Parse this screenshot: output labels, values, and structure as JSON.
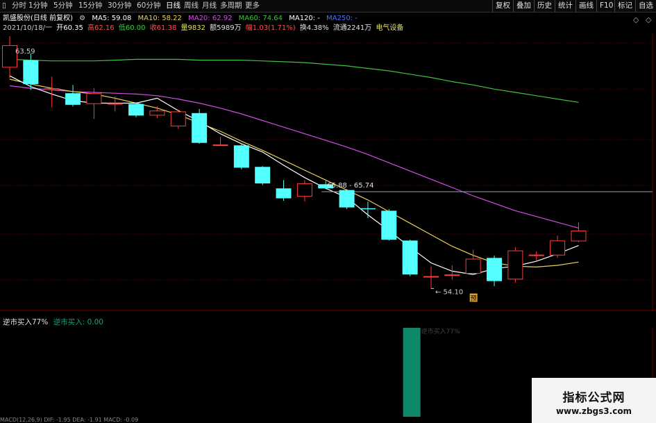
{
  "toolbar": {
    "periods": [
      "分时",
      "1分钟",
      "5分钟",
      "15分钟",
      "30分钟",
      "60分钟",
      "日线",
      "周线",
      "月线",
      "多周期",
      "更多"
    ],
    "active_period": "日线",
    "right_buttons": [
      "复权",
      "叠加",
      "历史",
      "统计",
      "画线",
      "F10",
      "标记",
      "自选"
    ]
  },
  "header": {
    "stock_name": "凯盛股份(日线 前复权)",
    "ma5_label": "MA5: 59.08",
    "ma10_label": "MA10: 58.22",
    "ma20_label": "MA20: 62.92",
    "ma60_label": "MA60: 74.64",
    "ma120_label": "MA120: -",
    "ma250_label": "MA250: -",
    "date": "2021/10/18/一",
    "open": "开60.35",
    "high": "高62.16",
    "low": "低60.00",
    "close": "收61.38",
    "volume": "量9832",
    "amount": "额5989万",
    "change": "幅1.03(1.71%)",
    "turnover": "换4.38%",
    "float_cap": "流通2241万",
    "sector": "电气设备"
  },
  "chart_labels": {
    "high_label": "63.59",
    "low_label": "54.10",
    "range_label": "65.88 - 65.74",
    "signal_badge": "预",
    "bar_annotation": "逆市买入77%"
  },
  "indicator": {
    "name": "逆市买入77%",
    "value_label": "逆市买入: 0.00",
    "bottom_text": "MACD(12,26,9) DIF: -1.95 DEA: -1.91 MACD: -0.09"
  },
  "watermark": {
    "title": "指标公式网",
    "url": "www.zbgs3.com"
  },
  "colors": {
    "up": "#ff3c3c",
    "down": "#54ffff",
    "ma5": "#ffffff",
    "ma10": "#e8d05a",
    "ma20": "#d050e0",
    "ma60": "#40c040",
    "grid": "#6b0000",
    "signal_bar": "#0e8a6a"
  },
  "chart_data": {
    "type": "candlestick",
    "price_range": [
      52.5,
      76.8
    ],
    "candles": [
      {
        "o": 73.6,
        "c": 76.3,
        "h": 77.4,
        "l": 72.3
      },
      {
        "o": 74.5,
        "c": 71.6,
        "h": 75.3,
        "l": 70.9
      },
      {
        "o": 70.9,
        "c": 71.1,
        "h": 72.5,
        "l": 68.8
      },
      {
        "o": 70.5,
        "c": 69.1,
        "h": 71.5,
        "l": 68.9
      },
      {
        "o": 69.2,
        "c": 70.5,
        "h": 71.1,
        "l": 67.4
      },
      {
        "o": 69.2,
        "c": 69.3,
        "h": 70.1,
        "l": 68.3
      },
      {
        "o": 69.2,
        "c": 67.8,
        "h": 69.4,
        "l": 67.6
      },
      {
        "o": 67.8,
        "c": 68.4,
        "h": 68.9,
        "l": 67.5
      },
      {
        "o": 66.5,
        "c": 68.3,
        "h": 68.5,
        "l": 66.2
      },
      {
        "o": 68.1,
        "c": 64.5,
        "h": 68.6,
        "l": 64.4
      },
      {
        "o": 64.3,
        "c": 64.3,
        "h": 65.2,
        "l": 64.2
      },
      {
        "o": 64.2,
        "c": 61.5,
        "h": 64.4,
        "l": 61.3
      },
      {
        "o": 61.6,
        "c": 59.6,
        "h": 61.7,
        "l": 59.4
      },
      {
        "o": 59.0,
        "c": 57.8,
        "h": 60.0,
        "l": 57.5
      },
      {
        "o": 58.0,
        "c": 59.6,
        "h": 60.0,
        "l": 57.4
      },
      {
        "o": 59.5,
        "c": 59.0,
        "h": 59.9,
        "l": 58.9
      },
      {
        "o": 58.8,
        "c": 56.7,
        "h": 58.9,
        "l": 56.5
      },
      {
        "o": 56.6,
        "c": 56.5,
        "h": 57.4,
        "l": 55.4
      },
      {
        "o": 56.3,
        "c": 52.8,
        "h": 56.5,
        "l": 52.7
      },
      {
        "o": 52.7,
        "c": 48.6,
        "h": 52.8,
        "l": 48.4
      },
      {
        "o": 48.4,
        "c": 48.4,
        "h": 49.6,
        "l": 46.9
      },
      {
        "o": 48.5,
        "c": 48.6,
        "h": 49.7,
        "l": 48.0
      },
      {
        "o": 48.7,
        "c": 50.5,
        "h": 51.6,
        "l": 48.7
      },
      {
        "o": 50.6,
        "c": 47.8,
        "h": 50.9,
        "l": 47.2
      },
      {
        "o": 48.0,
        "c": 51.5,
        "h": 51.9,
        "l": 47.6
      },
      {
        "o": 50.9,
        "c": 51.0,
        "h": 51.4,
        "l": 50.2
      },
      {
        "o": 50.9,
        "c": 52.7,
        "h": 53.3,
        "l": 50.6
      },
      {
        "o": 52.6,
        "c": 53.9,
        "h": 54.9,
        "l": 52.5
      }
    ],
    "ma5": [
      72.6,
      71.3,
      70.4,
      69.6,
      69.3,
      69.3,
      69.3,
      69.9,
      68.4,
      67.1,
      65.6,
      64.4,
      63.4,
      61.8,
      60.3,
      59.0,
      57.9,
      55.8,
      53.9,
      51.9,
      50.0,
      49.0,
      48.6,
      49.3,
      49.6,
      50.2,
      51.1,
      52.1
    ],
    "ma10": [
      72.2,
      71.6,
      71.1,
      70.7,
      70.4,
      69.9,
      69.3,
      68.7,
      67.9,
      66.9,
      65.9,
      64.7,
      63.6,
      62.4,
      61.2,
      60.0,
      58.8,
      57.6,
      56.2,
      54.8,
      53.4,
      52.0,
      50.9,
      50.0,
      49.6,
      49.5,
      49.7,
      50.1
    ],
    "ma20": [
      71.4,
      71.1,
      70.9,
      70.7,
      70.6,
      70.5,
      70.4,
      70.2,
      69.8,
      69.3,
      68.7,
      68.0,
      67.2,
      66.4,
      65.6,
      64.8,
      64.0,
      63.1,
      62.1,
      61.1,
      60.1,
      59.1,
      58.1,
      57.2,
      56.3,
      55.6,
      54.9,
      54.2
    ],
    "ma60": [
      74.6,
      74.5,
      74.4,
      74.4,
      74.4,
      74.5,
      74.6,
      74.6,
      74.6,
      74.5,
      74.5,
      74.5,
      74.4,
      74.3,
      74.2,
      74.0,
      73.8,
      73.5,
      73.2,
      72.8,
      72.4,
      71.9,
      71.5,
      71.0,
      70.6,
      70.2,
      69.8,
      69.4
    ],
    "indicator_bars": [
      0,
      0,
      0,
      0,
      0,
      0,
      0,
      0,
      0,
      0,
      0,
      0,
      0,
      0,
      0,
      0,
      0,
      0,
      0,
      100,
      0,
      0,
      0,
      0,
      0,
      0,
      0,
      0
    ]
  }
}
